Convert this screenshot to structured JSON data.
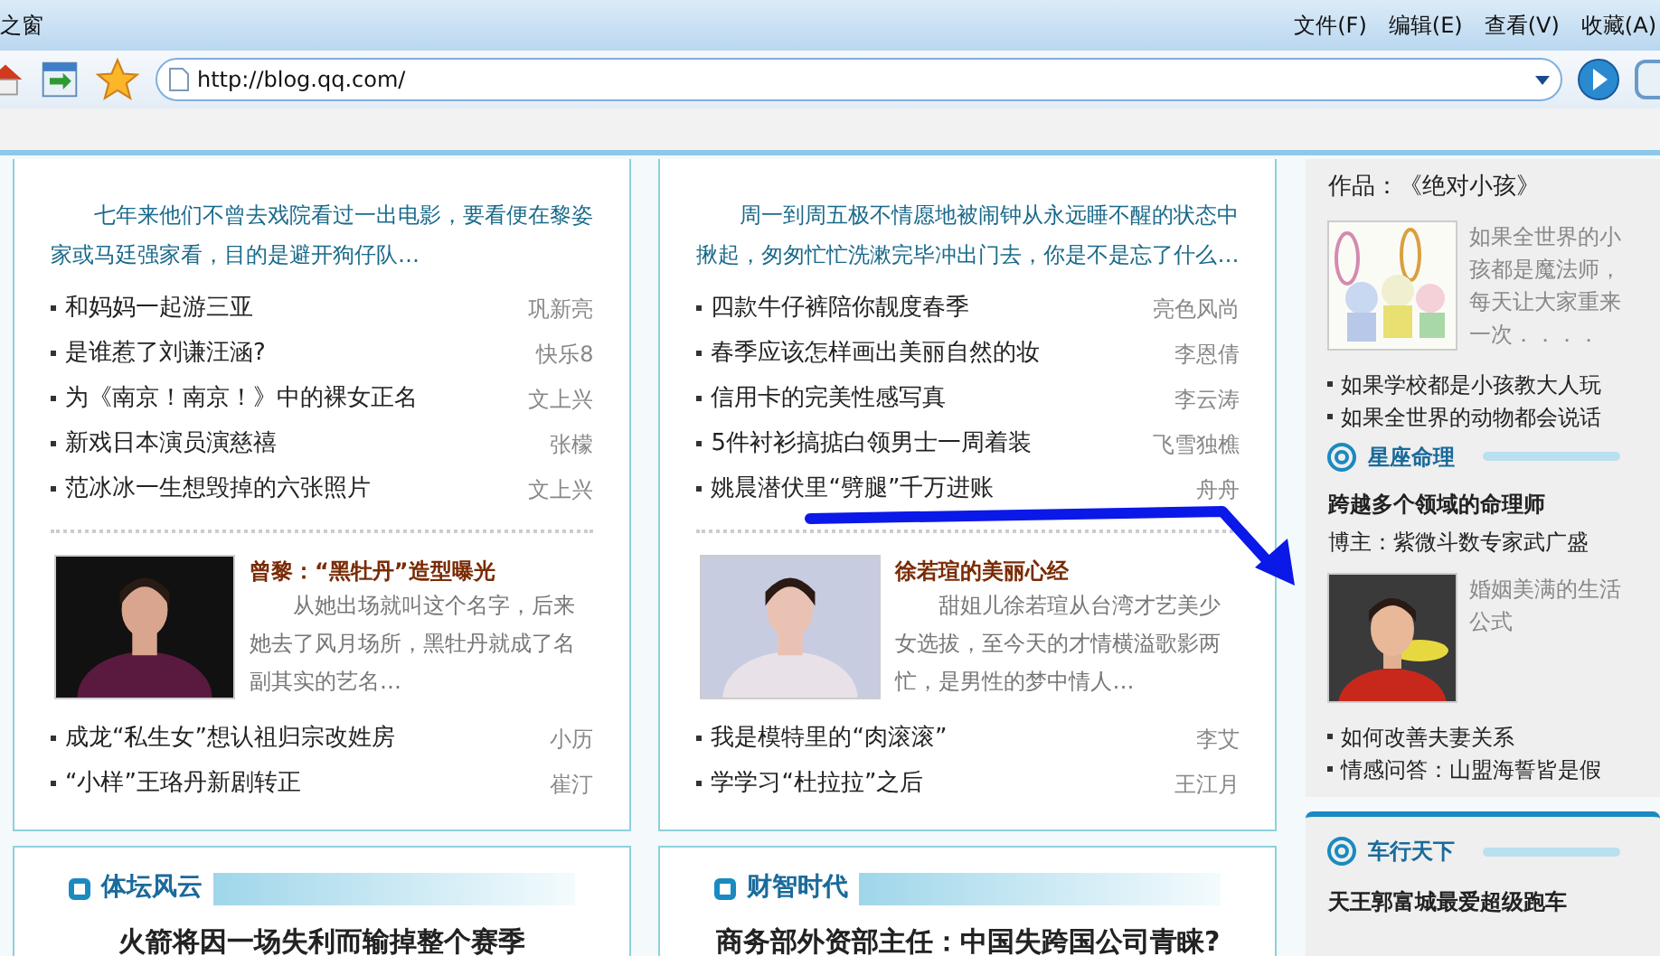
{
  "window": {
    "title": "之窗",
    "menu": [
      "文件(F)",
      "编辑(E)",
      "查看(V)",
      "收藏(A)"
    ]
  },
  "address_bar": {
    "value": "http://blog.qq.com/"
  },
  "columns": [
    {
      "summary": "七年来他们不曾去戏院看过一出电影，要看便在黎姿家或马廷强家看，目的是避开狗仔队…",
      "list": [
        {
          "title": "和妈妈一起游三亚",
          "author": "巩新亮"
        },
        {
          "title": "是谁惹了刘谦汪涵?",
          "author": "快乐8"
        },
        {
          "title": "为《南京！南京！》中的裸女正名",
          "author": "文上兴"
        },
        {
          "title": "新戏日本演员演慈禧",
          "author": "张檬"
        },
        {
          "title": "范冰冰一生想毁掉的六张照片",
          "author": "文上兴"
        }
      ],
      "feature": {
        "title": "曾黎：“黑牡丹”造型曝光",
        "summary": "从她出场就叫这个名字，后来她去了风月场所，黑牡丹就成了名副其实的艺名…"
      },
      "list2": [
        {
          "title": "成龙“私生女”想认祖归宗改姓房",
          "author": "小历"
        },
        {
          "title": "“小样”王珞丹新剧转正",
          "author": "崔汀"
        }
      ],
      "next_section": {
        "title": "体坛风云",
        "headline": "火箭将因一场失利而输掉整个赛季"
      }
    },
    {
      "summary": "周一到周五极不情愿地被闹钟从永远睡不醒的状态中揪起，匆匆忙忙洗漱完毕冲出门去，你是不是忘了什么…",
      "list": [
        {
          "title": "四款牛仔裤陪你靓度春季",
          "author": "亮色风尚"
        },
        {
          "title": "春季应该怎样画出美丽自然的妆",
          "author": "李恩倩"
        },
        {
          "title": "信用卡的完美性感写真",
          "author": "李云涛"
        },
        {
          "title": "5件衬衫搞掂白领男士一周着装",
          "author": "飞雪独樵"
        },
        {
          "title": "姚晨潜伏里“劈腿”千万进账",
          "author": "舟舟"
        }
      ],
      "feature": {
        "title": "徐若瑄的美丽心经",
        "summary": "甜姐儿徐若瑄从台湾才艺美少女选拔，至今天的才情横溢歌影两忙，是男性的梦中情人…"
      },
      "list2": [
        {
          "title": "我是模特里的“肉滚滚”",
          "author": "李艾"
        },
        {
          "title": "学学习“杜拉拉”之后",
          "author": "王江月"
        }
      ],
      "next_section": {
        "title": "财智时代",
        "headline": "商务部外资部主任：中国失跨国公司青睐?"
      }
    }
  ],
  "sidebar": {
    "work": "作品：《绝对小孩》",
    "feature_text": "如果全世界的小孩都是魔法师，每天让大家重来一次．．．．",
    "links": [
      "如果学校都是小孩教大人玩",
      "如果全世界的动物都会说话"
    ],
    "section": {
      "title": "星座命理",
      "headline": "跨越多个领域的命理师",
      "blogger": "博主：紫微斗数专家武广盛",
      "feature_text": "婚姻美满的生活公式",
      "links": [
        "如何改善夫妻关系",
        "情感问答：山盟海誓皆是假"
      ]
    },
    "next_section": {
      "title": "车行天下",
      "headline": "天王郭富城最爱超级跑车"
    }
  }
}
